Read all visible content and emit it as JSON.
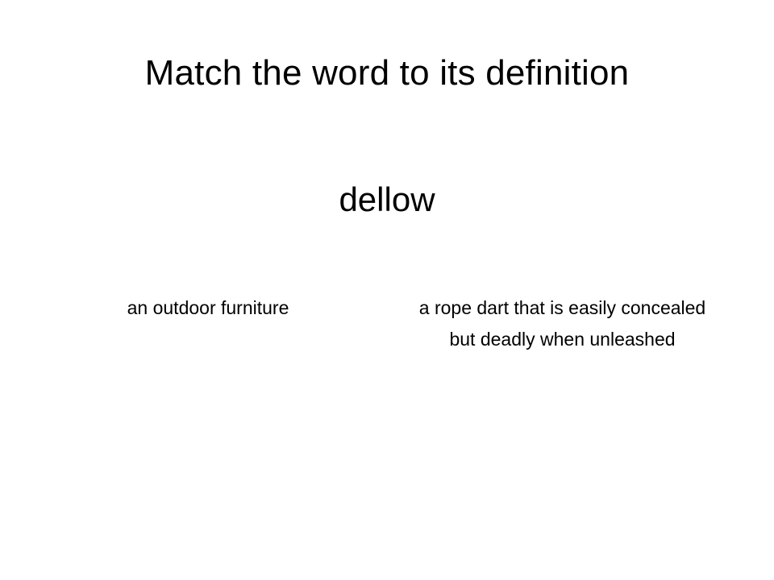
{
  "slide": {
    "title": "Match the word to its definition",
    "word": "dellow",
    "options": [
      {
        "text": "an outdoor furniture"
      },
      {
        "text": "a rope dart that is easily concealed but deadly when unleashed"
      }
    ]
  }
}
